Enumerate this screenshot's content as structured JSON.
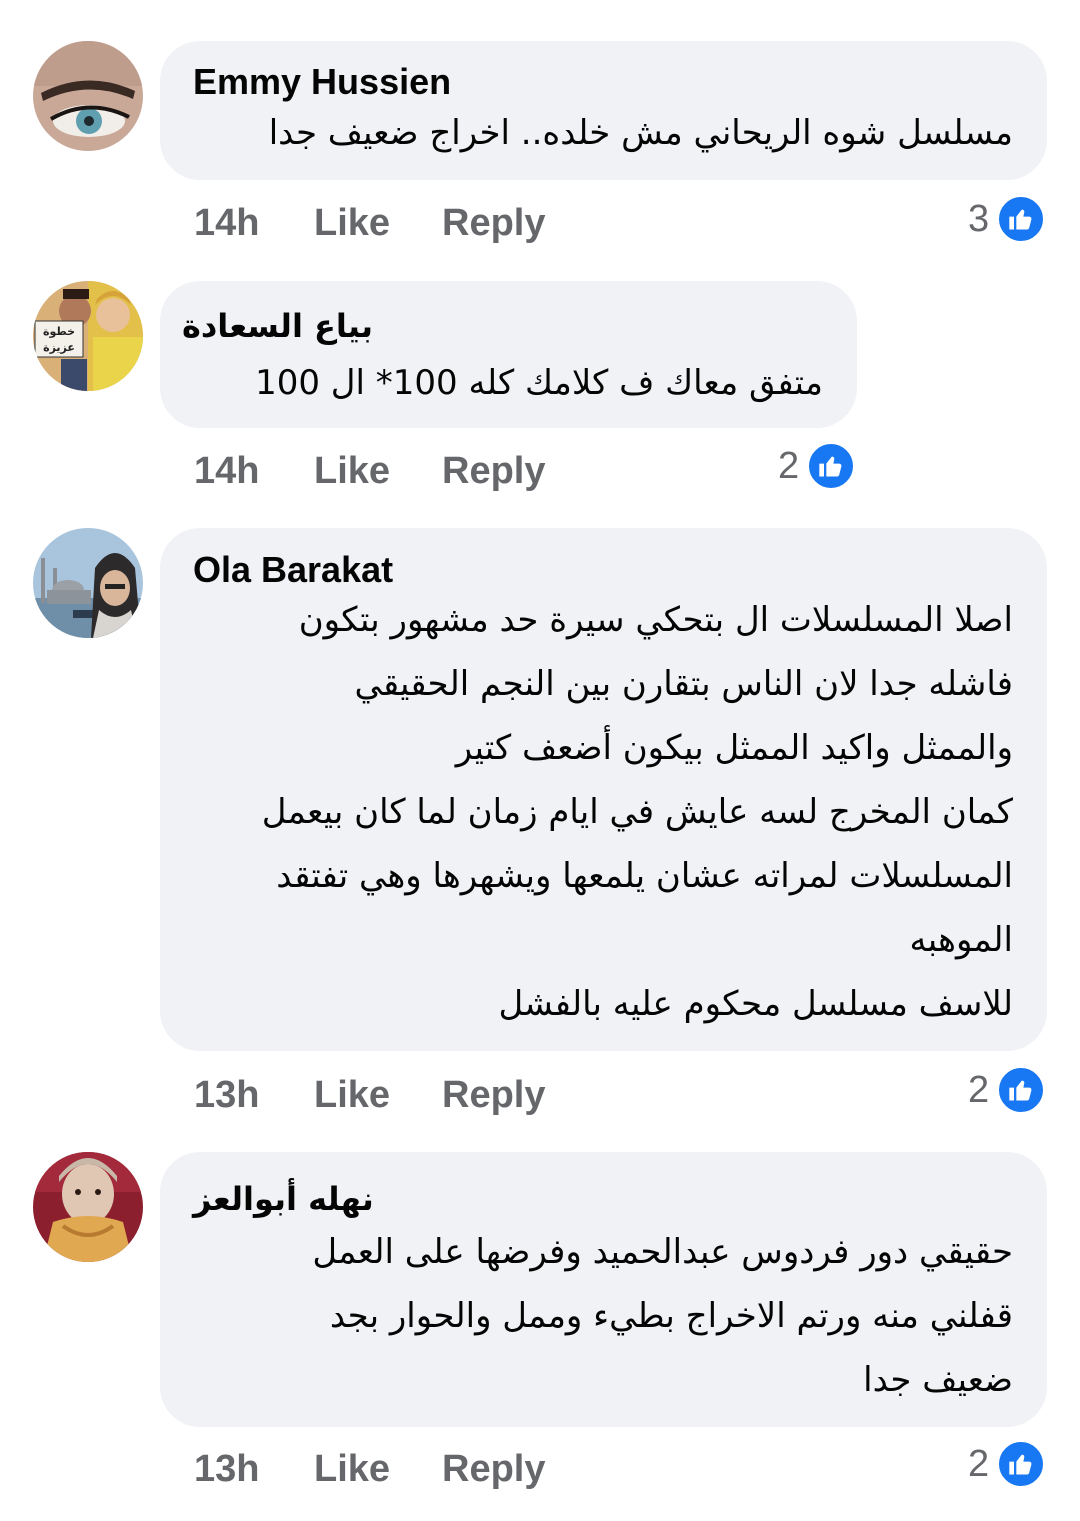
{
  "comments": [
    {
      "author": "Emmy Hussien",
      "lines": [
        "مسلسل شوه الريحاني مش خلده.. اخراج ضعيف جدا"
      ],
      "time": "14h",
      "like_label": "Like",
      "reply_label": "Reply",
      "reaction_count": "3",
      "reaction_icon": "like-icon"
    },
    {
      "author": "بياع السعادة",
      "lines": [
        "متفق معاك ف كلامك كله 100* ال 100"
      ],
      "time": "14h",
      "like_label": "Like",
      "reply_label": "Reply",
      "reaction_count": "2",
      "reaction_icon": "like-icon",
      "avatar_text": "خطوة عزيزة"
    },
    {
      "author": "Ola Barakat",
      "lines": [
        "اصلا المسلسلات ال بتحكي سيرة حد مشهور بتكون",
        "فاشله جدا لان الناس بتقارن بين النجم الحقيقي",
        "والممثل واكيد الممثل بيكون أضعف كتير",
        "كمان المخرج لسه عايش في ايام زمان لما كان بيعمل",
        "المسلسلات لمراته عشان يلمعها ويشهرها وهي تفتقد",
        "الموهبه",
        "للاسف مسلسل محكوم عليه بالفشل"
      ],
      "time": "13h",
      "like_label": "Like",
      "reply_label": "Reply",
      "reaction_count": "2",
      "reaction_icon": "like-icon"
    },
    {
      "author": "نهله أبوالعز",
      "lines": [
        "حقيقي دور فردوس عبدالحميد وفرضها على العمل",
        "قفلني منه ورتم الاخراج بطيء وممل والحوار بجد",
        "ضعيف جدا"
      ],
      "time": "13h",
      "like_label": "Like",
      "reply_label": "Reply",
      "reaction_count": "2",
      "reaction_icon": "like-icon"
    }
  ],
  "colors": {
    "bubble": "#f0f2f5",
    "meta_text": "#65676b",
    "like_blue": "#1877f2"
  }
}
